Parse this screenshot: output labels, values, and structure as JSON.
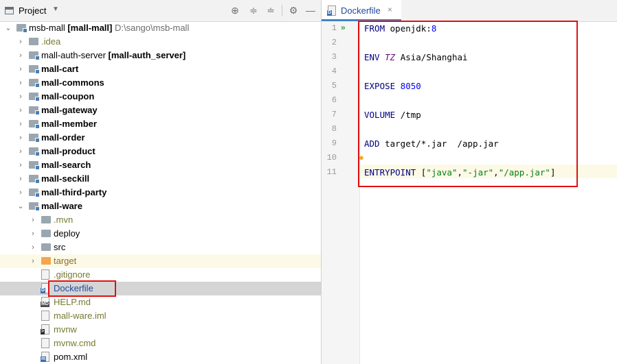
{
  "project_panel": {
    "title": "Project",
    "toolbar_icons": [
      "target-icon",
      "expand-icon",
      "collapse-icon",
      "gear-icon",
      "minimize-icon"
    ],
    "tree": [
      {
        "name": "msb-mall",
        "module": "[mall-mall]",
        "path": "D:\\sango\\msb-mall",
        "indent": 0,
        "expanded": true,
        "icon": "module-folder"
      },
      {
        "name": ".idea",
        "indent": 1,
        "icon": "folder"
      },
      {
        "name": "mall-auth-server",
        "module": "[mall-auth_server]",
        "indent": 1,
        "icon": "module-folder"
      },
      {
        "name": "mall-cart",
        "indent": 1,
        "icon": "module-folder",
        "bold": true
      },
      {
        "name": "mall-commons",
        "indent": 1,
        "icon": "module-folder",
        "bold": true
      },
      {
        "name": "mall-coupon",
        "indent": 1,
        "icon": "module-folder",
        "bold": true
      },
      {
        "name": "mall-gateway",
        "indent": 1,
        "icon": "module-folder",
        "bold": true
      },
      {
        "name": "mall-member",
        "indent": 1,
        "icon": "module-folder",
        "bold": true
      },
      {
        "name": "mall-order",
        "indent": 1,
        "icon": "module-folder",
        "bold": true
      },
      {
        "name": "mall-product",
        "indent": 1,
        "icon": "module-folder",
        "bold": true
      },
      {
        "name": "mall-search",
        "indent": 1,
        "icon": "module-folder",
        "bold": true
      },
      {
        "name": "mall-seckill",
        "indent": 1,
        "icon": "module-folder",
        "bold": true
      },
      {
        "name": "mall-third-party",
        "indent": 1,
        "icon": "module-folder",
        "bold": true
      },
      {
        "name": "mall-ware",
        "indent": 1,
        "icon": "module-folder",
        "bold": true,
        "expanded": true
      },
      {
        "name": ".mvn",
        "indent": 2,
        "icon": "folder"
      },
      {
        "name": "deploy",
        "indent": 2,
        "icon": "folder"
      },
      {
        "name": "src",
        "indent": 2,
        "icon": "folder"
      },
      {
        "name": "target",
        "indent": 2,
        "icon": "orange-folder"
      },
      {
        "name": ".gitignore",
        "indent": 3,
        "icon": "gitignore-file"
      },
      {
        "name": "Dockerfile",
        "indent": 3,
        "icon": "docker-file",
        "selected": true
      },
      {
        "name": "HELP.md",
        "indent": 3,
        "icon": "markdown-file"
      },
      {
        "name": "mall-ware.iml",
        "indent": 3,
        "icon": "iml-file"
      },
      {
        "name": "mvnw",
        "indent": 3,
        "icon": "shell-file"
      },
      {
        "name": "mvnw.cmd",
        "indent": 3,
        "icon": "text-file"
      },
      {
        "name": "pom.xml",
        "indent": 3,
        "icon": "maven-file"
      }
    ]
  },
  "editor": {
    "tab_label": "Dockerfile",
    "tab_close": "×",
    "line_numbers": [
      "1",
      "2",
      "3",
      "4",
      "5",
      "6",
      "7",
      "8",
      "9",
      "10",
      "11"
    ],
    "lines": [
      [
        {
          "t": "FROM ",
          "c": "kw"
        },
        {
          "t": "openjdk:",
          "c": ""
        },
        {
          "t": "8",
          "c": "num"
        }
      ],
      [],
      [
        {
          "t": "ENV ",
          "c": "kw"
        },
        {
          "t": "TZ",
          "c": "it"
        },
        {
          "t": " Asia/Shanghai",
          "c": ""
        }
      ],
      [],
      [
        {
          "t": "EXPOSE ",
          "c": "kw"
        },
        {
          "t": "8050",
          "c": "num"
        }
      ],
      [],
      [
        {
          "t": "VOLUME ",
          "c": "kw"
        },
        {
          "t": "/tmp",
          "c": ""
        }
      ],
      [],
      [
        {
          "t": "ADD ",
          "c": "kw"
        },
        {
          "t": "target/*.jar  /app.jar",
          "c": ""
        }
      ],
      [],
      [
        {
          "t": "ENTRYPOINT ",
          "c": "kw"
        },
        {
          "t": "[",
          "c": ""
        },
        {
          "t": "\"java\"",
          "c": "str"
        },
        {
          "t": ",",
          "c": ""
        },
        {
          "t": "\"-jar\"",
          "c": "str"
        },
        {
          "t": ",",
          "c": ""
        },
        {
          "t": "\"/app.jar\"",
          "c": "str"
        },
        {
          "t": "]",
          "c": ""
        }
      ]
    ],
    "gutter_icons": [
      "run-icon",
      "lightbulb-icon"
    ],
    "colors": {
      "keyword": "#000080",
      "number": "#0000ff",
      "string": "#067d17",
      "selection_box": "#e01010"
    }
  }
}
